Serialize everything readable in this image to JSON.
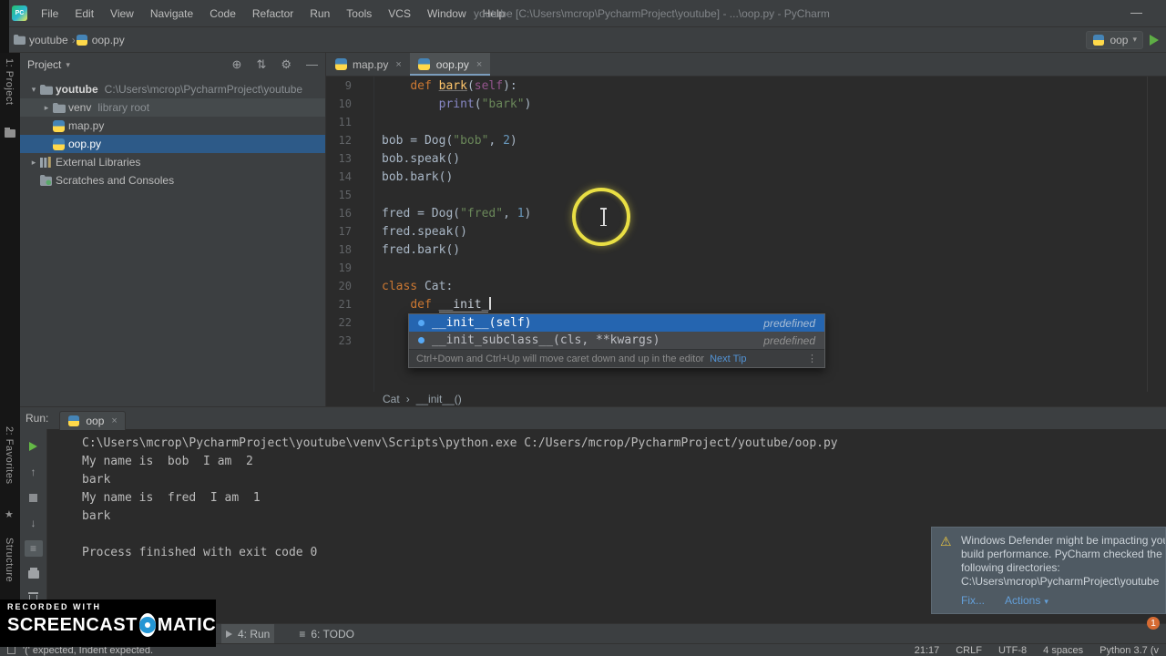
{
  "titlebar": {
    "logo": "PC",
    "menu": [
      "File",
      "Edit",
      "View",
      "Navigate",
      "Code",
      "Refactor",
      "Run",
      "Tools",
      "VCS",
      "Window",
      "Help"
    ],
    "title": "youtube [C:\\Users\\mcrop\\PycharmProject\\youtube] - ...\\oop.py - PyCharm",
    "minimize": "—"
  },
  "navbar": {
    "breadcrumbs": [
      "youtube",
      "oop.py"
    ],
    "run_config": "oop"
  },
  "tool_strips": {
    "project": "1: Project",
    "favorites": "2: Favorites",
    "structure": "Structure"
  },
  "project": {
    "header": "Project",
    "tree": [
      {
        "label": "youtube",
        "hint": "C:\\Users\\mcrop\\PycharmProject\\youtube",
        "icon": "folder",
        "arrow": "down",
        "depth": 0,
        "bold": true
      },
      {
        "label": "venv",
        "hint": "library root",
        "icon": "folder",
        "arrow": "right",
        "depth": 1,
        "hover": true
      },
      {
        "label": "map.py",
        "icon": "python",
        "depth": 1
      },
      {
        "label": "oop.py",
        "icon": "python",
        "depth": 1,
        "selected": true
      },
      {
        "label": "External Libraries",
        "icon": "library",
        "arrow": "right",
        "depth": 0
      },
      {
        "label": "Scratches and Consoles",
        "icon": "scratch",
        "depth": 0
      }
    ]
  },
  "editor": {
    "tabs": [
      {
        "label": "map.py",
        "active": false
      },
      {
        "label": "oop.py",
        "active": true
      }
    ],
    "breadcrumb": [
      "Cat",
      "__init__()"
    ],
    "lines": [
      {
        "n": 9,
        "seg": [
          [
            "    ",
            "pl"
          ],
          [
            "def ",
            "kw"
          ],
          [
            "bark",
            "fn"
          ],
          [
            "(",
            "pl"
          ],
          [
            "self",
            "slf"
          ],
          [
            "):",
            "pl"
          ]
        ]
      },
      {
        "n": 10,
        "seg": [
          [
            "        ",
            "pl"
          ],
          [
            "print",
            "bi"
          ],
          [
            "(",
            "pl"
          ],
          [
            "\"bark\"",
            "str"
          ],
          [
            ")",
            "pl"
          ]
        ]
      },
      {
        "n": 11,
        "seg": []
      },
      {
        "n": 12,
        "seg": [
          [
            "bob = Dog(",
            "pl"
          ],
          [
            "\"bob\"",
            "str"
          ],
          [
            ", ",
            "pl"
          ],
          [
            "2",
            "num"
          ],
          [
            ")",
            "pl"
          ]
        ]
      },
      {
        "n": 13,
        "seg": [
          [
            "bob.speak()",
            "pl"
          ]
        ]
      },
      {
        "n": 14,
        "seg": [
          [
            "bob.bark()",
            "pl"
          ]
        ]
      },
      {
        "n": 15,
        "seg": []
      },
      {
        "n": 16,
        "seg": [
          [
            "fred = Dog(",
            "pl"
          ],
          [
            "\"fred\"",
            "str"
          ],
          [
            ", ",
            "pl"
          ],
          [
            "1",
            "num"
          ],
          [
            ")",
            "pl"
          ]
        ]
      },
      {
        "n": 17,
        "seg": [
          [
            "fred.speak()",
            "pl"
          ]
        ]
      },
      {
        "n": 18,
        "seg": [
          [
            "fred.bark()",
            "pl"
          ]
        ]
      },
      {
        "n": 19,
        "seg": []
      },
      {
        "n": 20,
        "seg": [
          [
            "class ",
            "kw"
          ],
          [
            "Cat:",
            "pl"
          ]
        ]
      },
      {
        "n": 21,
        "seg": [
          [
            "    ",
            "pl"
          ],
          [
            "def ",
            "kw"
          ],
          [
            "__init_",
            "typed"
          ],
          [
            "",
            "caret"
          ]
        ]
      },
      {
        "n": 22,
        "seg": []
      },
      {
        "n": 23,
        "seg": []
      }
    ]
  },
  "completion": {
    "items": [
      {
        "label": "__init__(self)",
        "tail": "predefined",
        "selected": true
      },
      {
        "label": "__init_subclass__(cls, **kwargs)",
        "tail": "predefined",
        "selected": false
      }
    ],
    "hint": "Ctrl+Down and Ctrl+Up will move caret down and up in the editor",
    "hint_link": "Next Tip"
  },
  "run_panel": {
    "label": "Run:",
    "tab": "oop",
    "console": [
      "C:\\Users\\mcrop\\PycharmProject\\youtube\\venv\\Scripts\\python.exe C:/Users/mcrop/PycharmProject/youtube/oop.py",
      "My name is  bob  I am  2",
      "bark",
      "My name is  fred  I am  1",
      "bark",
      "",
      "Process finished with exit code 0"
    ]
  },
  "notification": {
    "lines": [
      "Windows Defender might be impacting you",
      "build performance. PyCharm checked the",
      "following directories:",
      "C:\\Users\\mcrop\\PycharmProject\\youtube"
    ],
    "links": [
      "Fix...",
      "Actions"
    ]
  },
  "bottom_bar": {
    "items": [
      "4: Run",
      "6: TODO"
    ]
  },
  "status_bar": {
    "message": "'(' expected, Indent expected.",
    "right": [
      "21:17",
      "CRLF",
      "UTF-8",
      "4 spaces",
      "Python 3.7 (v"
    ],
    "badge": "1"
  },
  "watermark": {
    "small": "RECORDED WITH",
    "brand_left": "SCREENCAST",
    "brand_right": "MATIC"
  }
}
